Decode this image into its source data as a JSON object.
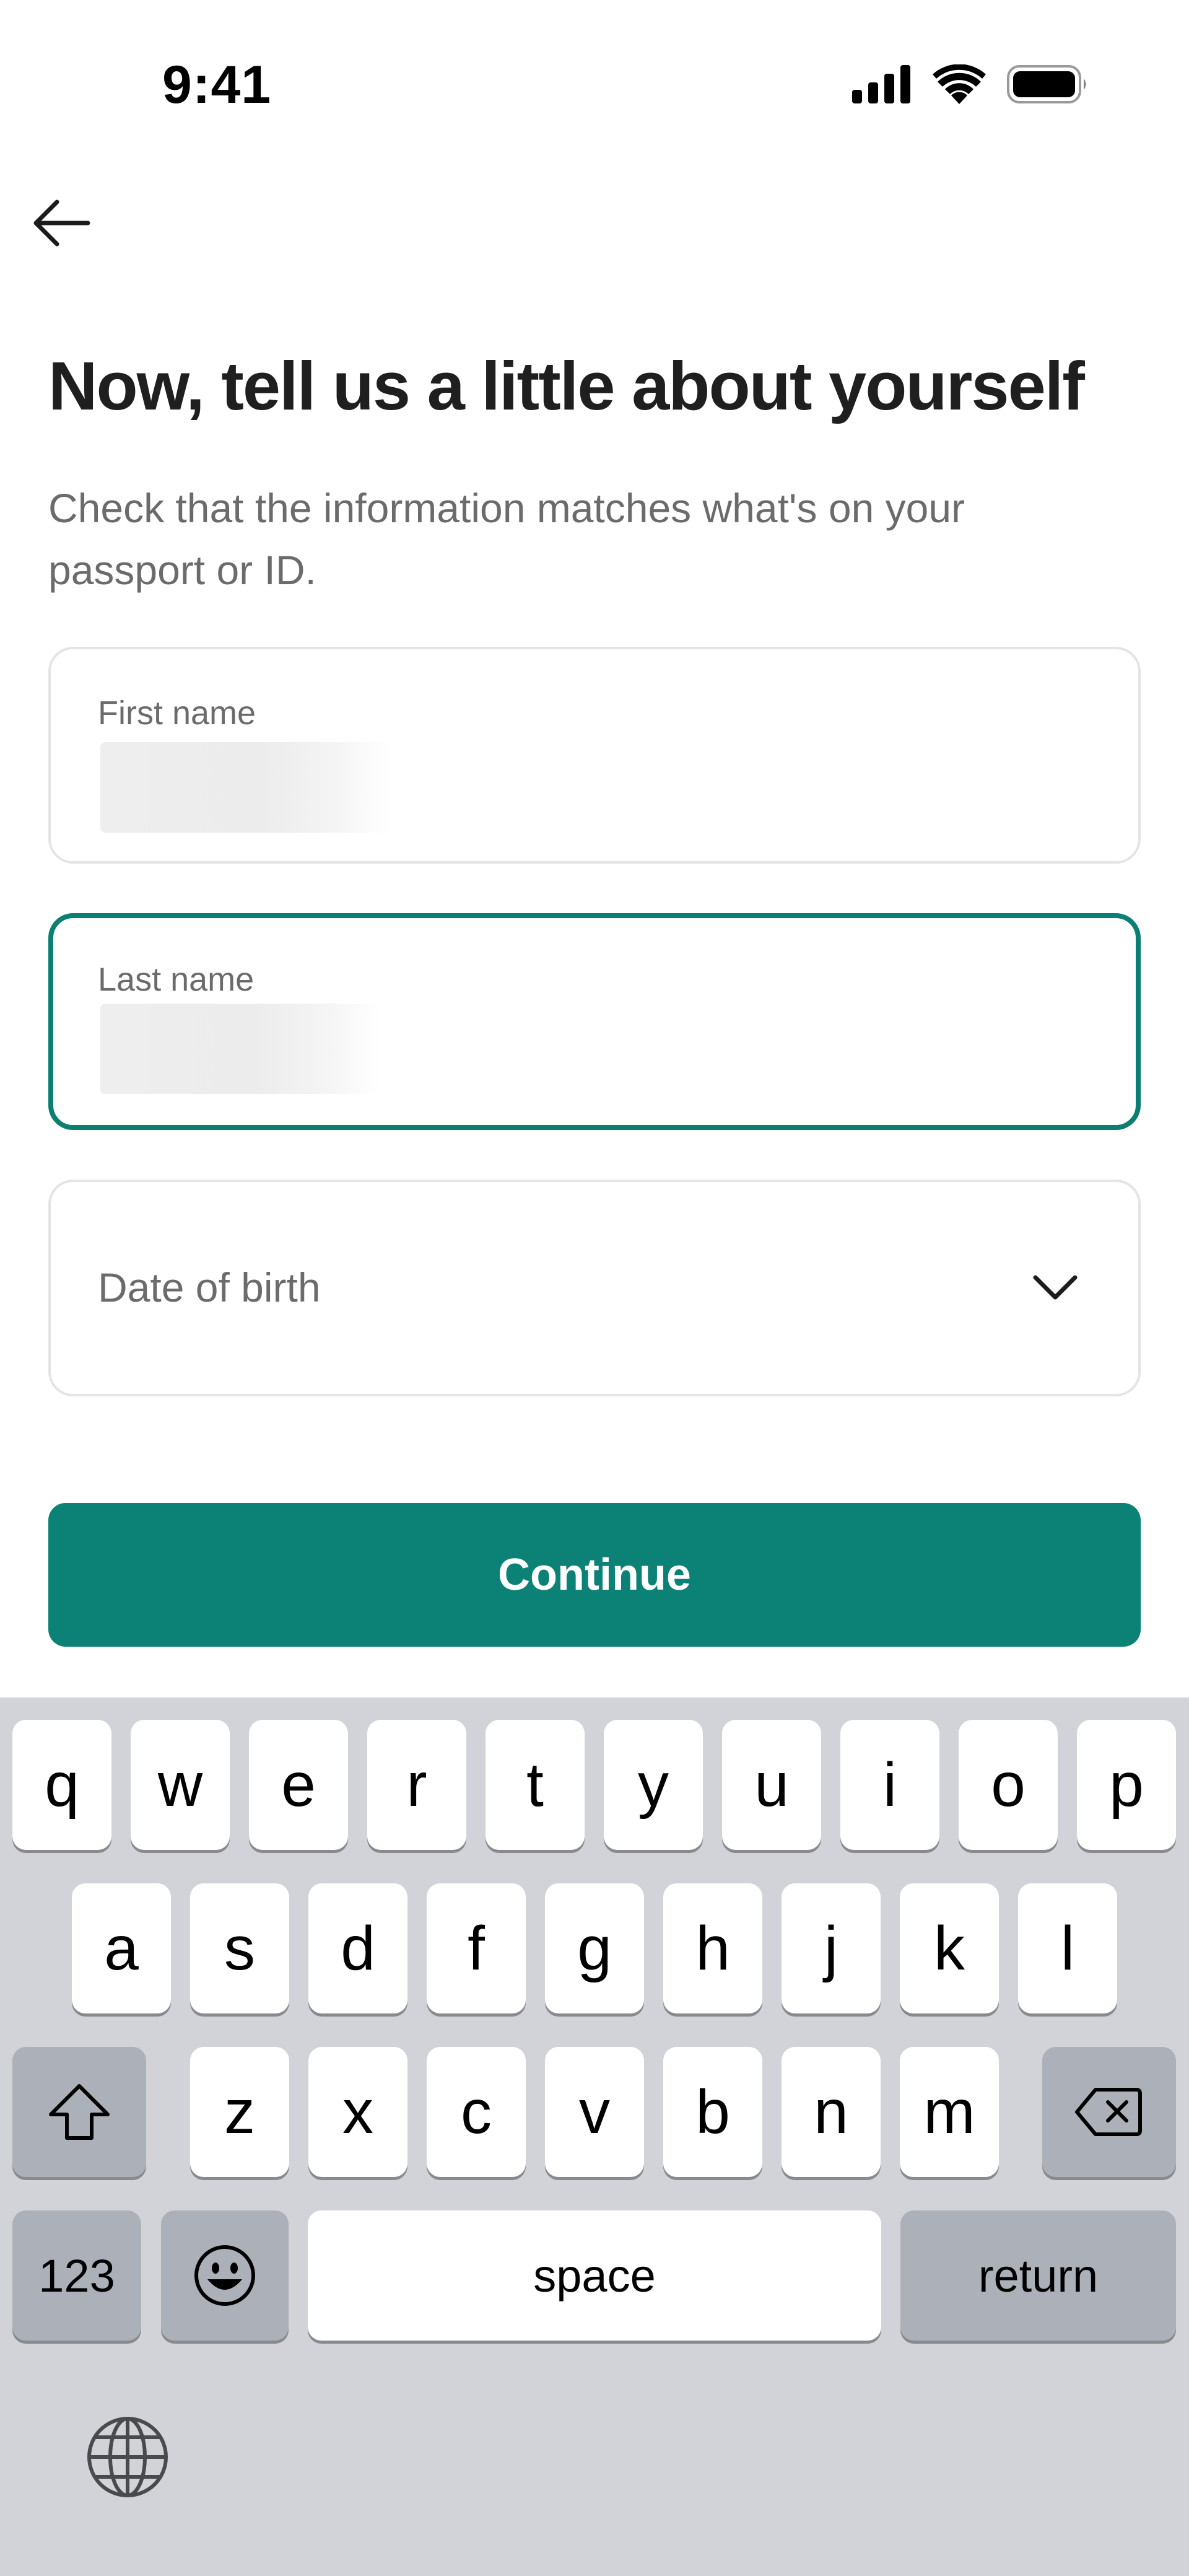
{
  "status_bar": {
    "time": "9:41",
    "icons": [
      "cellular-signal-icon",
      "wifi-icon",
      "battery-icon"
    ]
  },
  "nav": {
    "back_icon": "arrow-left-icon"
  },
  "heading": {
    "title": "Now, tell us a little about yourself",
    "subtitle": "Check that the information matches what's on your passport or ID."
  },
  "form": {
    "first_name": {
      "label": "First name",
      "value_redacted": true
    },
    "last_name": {
      "label": "Last name",
      "value_redacted": true,
      "focused": true
    },
    "date_of_birth": {
      "label": "Date of birth",
      "icon": "chevron-down-icon"
    }
  },
  "continue_button": {
    "label": "Continue"
  },
  "keyboard": {
    "row1": [
      "q",
      "w",
      "e",
      "r",
      "t",
      "y",
      "u",
      "i",
      "o",
      "p"
    ],
    "row2": [
      "a",
      "s",
      "d",
      "f",
      "g",
      "h",
      "j",
      "k",
      "l"
    ],
    "row3": [
      "z",
      "x",
      "c",
      "v",
      "b",
      "n",
      "m"
    ],
    "shift_icon": "shift-icon",
    "delete_icon": "backspace-icon",
    "numbers_label": "123",
    "emoji_icon": "emoji-icon",
    "space_label": "space",
    "return_label": "return",
    "globe_icon": "globe-icon"
  },
  "colors": {
    "accent": "#0c8276",
    "focus_border": "#0c7f73",
    "keyboard_bg": "#d1d3d9"
  }
}
